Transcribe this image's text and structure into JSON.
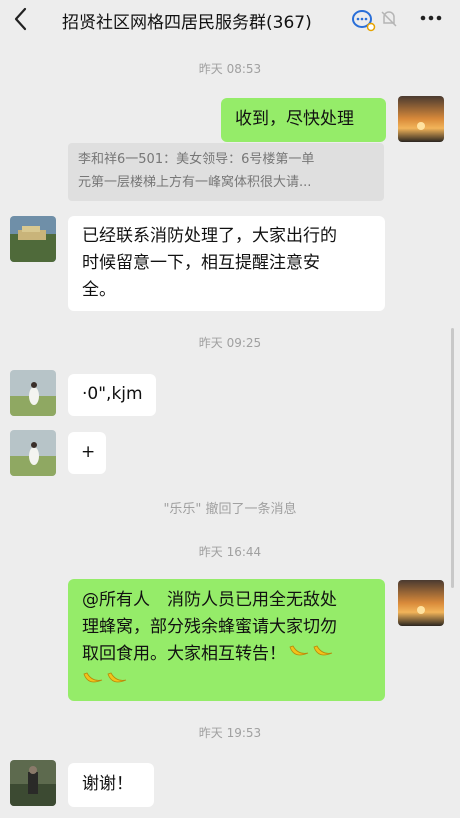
{
  "header": {
    "title": "招贤社区网格四居民服务群(367)"
  },
  "messages": [
    {
      "kind": "time",
      "text": "昨天 08:53"
    },
    {
      "kind": "msg",
      "side": "out",
      "text": "收到，尽快处理"
    },
    {
      "kind": "quote",
      "lines": [
        "李和祥6一501：美女领导：6号楼第一单",
        "元第一层楼梯上方有一峰窝体积很大请..."
      ]
    },
    {
      "kind": "msg",
      "side": "in",
      "lines": [
        "已经联系消防处理了，大家出行的",
        "时候留意一下，相互提醒注意安",
        "全。"
      ]
    },
    {
      "kind": "time",
      "text": "昨天 09:25"
    },
    {
      "kind": "msg",
      "side": "in",
      "text": "·0\",kjm"
    },
    {
      "kind": "msg",
      "side": "in",
      "text": "+"
    },
    {
      "kind": "system",
      "text": "\"乐乐\" 撤回了一条消息"
    },
    {
      "kind": "time",
      "text": "昨天 16:44"
    },
    {
      "kind": "msg",
      "side": "out",
      "lines": [
        "@所有人　消防人员已用全无敌处",
        "理蜂窝，部分残余蜂蜜请大家切勿",
        "取回食用。大家相互转告！"
      ],
      "emoji": "banana"
    },
    {
      "kind": "time",
      "text": "昨天 19:53"
    },
    {
      "kind": "msg",
      "side": "in",
      "text": "谢谢！"
    }
  ],
  "icons": {
    "back": "chevron-left-icon",
    "chat": "group-chat-icon",
    "mute": "mute-bell-icon",
    "more": "more-dots-icon",
    "emoji": "banana-icon"
  },
  "colors": {
    "background": "#ededed",
    "outgoing_bubble": "#95ec69",
    "incoming_bubble": "#ffffff",
    "timestamp": "#a0a0a0"
  }
}
